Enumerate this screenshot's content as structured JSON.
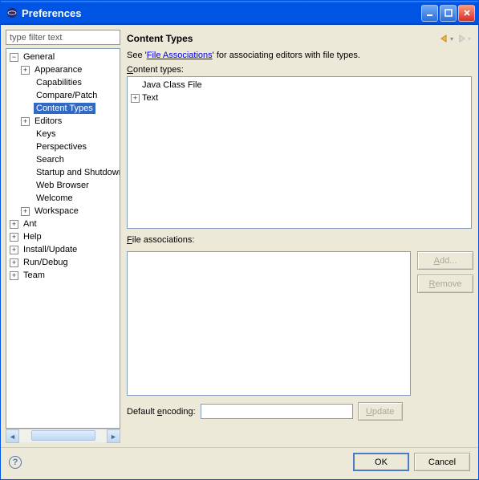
{
  "window": {
    "title": "Preferences"
  },
  "filter": {
    "placeholder": "type filter text"
  },
  "tree": {
    "general": "General",
    "appearance": "Appearance",
    "capabilities": "Capabilities",
    "compare": "Compare/Patch",
    "contentTypes": "Content Types",
    "editors": "Editors",
    "keys": "Keys",
    "perspectives": "Perspectives",
    "search": "Search",
    "startup": "Startup and Shutdown",
    "webBrowser": "Web Browser",
    "welcome": "Welcome",
    "workspace": "Workspace",
    "ant": "Ant",
    "help": "Help",
    "install": "Install/Update",
    "run": "Run/Debug",
    "team": "Team"
  },
  "page": {
    "title": "Content Types",
    "desc_pre": "See '",
    "desc_link": "File Associations",
    "desc_post": "' for associating editors with file types.",
    "ct_label": "Content types:",
    "fa_label": "File associations:",
    "enc_label": "Default encoding:",
    "add": "Add...",
    "remove": "Remove",
    "update": "Update",
    "ct_item1": "Java Class File",
    "ct_item2": "Text"
  },
  "buttons": {
    "ok": "OK",
    "cancel": "Cancel"
  },
  "mnemonics": {
    "ct_u": "C",
    "ct_rest": "ontent types:",
    "fa_u": "F",
    "fa_rest": "ile associations:",
    "add_u": "A",
    "add_rest": "dd...",
    "rem_u": "R",
    "rem_rest": "emove",
    "enc_pre": "Default ",
    "enc_u": "e",
    "enc_rest": "ncoding:",
    "upd_u": "U",
    "upd_rest": "pdate"
  }
}
